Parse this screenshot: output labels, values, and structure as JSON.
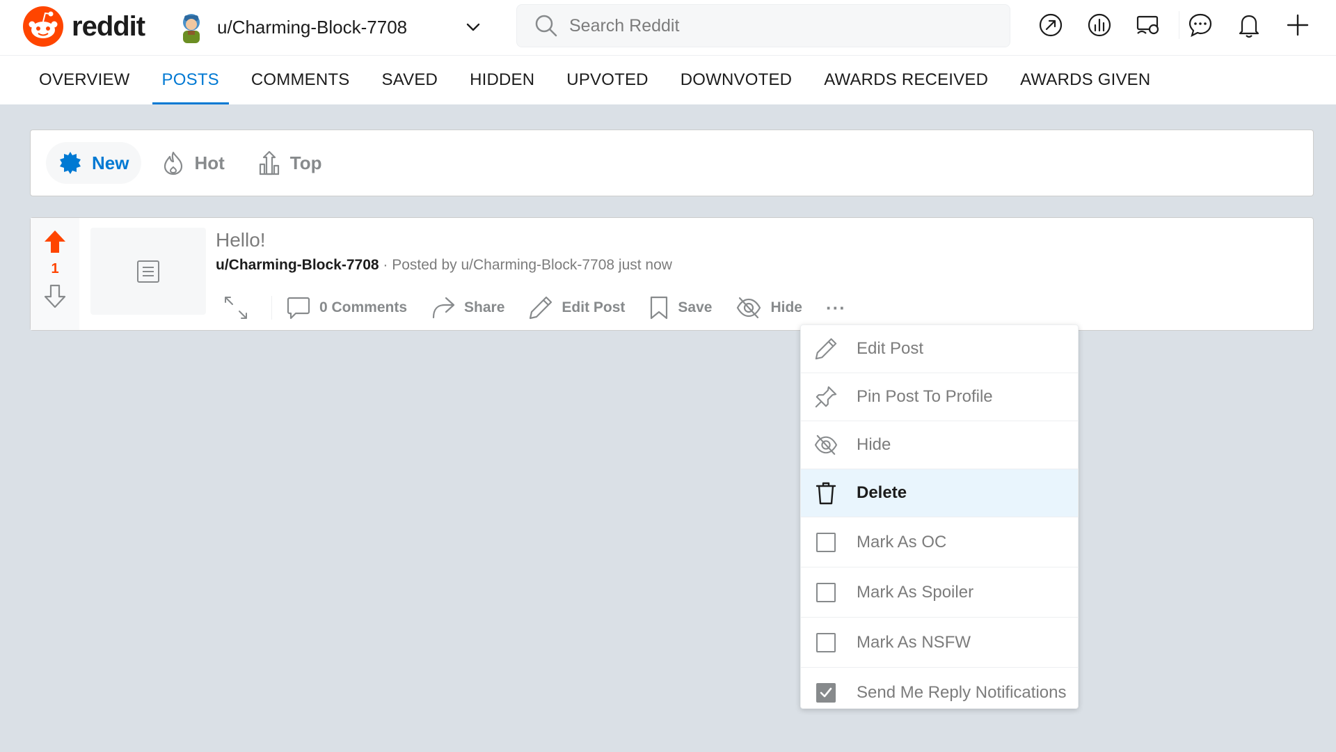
{
  "colors": {
    "brand": "#ff4500",
    "accent": "#0079d3",
    "muted": "#878a8c",
    "menu_highlight": "#e9f5fd"
  },
  "header": {
    "logo_text": "reddit",
    "username": "u/Charming-Block-7708",
    "search_placeholder": "Search Reddit",
    "icons": [
      "popular-icon",
      "stats-icon",
      "coins-icon",
      "chat-icon",
      "notification-icon",
      "create-post-icon"
    ]
  },
  "tabs": [
    {
      "label": "OVERVIEW"
    },
    {
      "label": "POSTS",
      "active": true
    },
    {
      "label": "COMMENTS"
    },
    {
      "label": "SAVED"
    },
    {
      "label": "HIDDEN"
    },
    {
      "label": "UPVOTED"
    },
    {
      "label": "DOWNVOTED"
    },
    {
      "label": "AWARDS RECEIVED"
    },
    {
      "label": "AWARDS GIVEN"
    }
  ],
  "sort": {
    "new": "New",
    "hot": "Hot",
    "top": "Top"
  },
  "post": {
    "score": "1",
    "title": "Hello!",
    "author": "u/Charming-Block-7708",
    "posted_by": "· Posted by u/Charming-Block-7708 just now",
    "actions": {
      "comments": "0 Comments",
      "share": "Share",
      "edit": "Edit Post",
      "save": "Save",
      "hide": "Hide",
      "more": "···"
    }
  },
  "menu": {
    "edit": "Edit Post",
    "pin": "Pin Post To Profile",
    "hide": "Hide",
    "delete": "Delete",
    "mark_oc": "Mark As OC",
    "mark_spoiler": "Mark As Spoiler",
    "mark_nsfw": "Mark As NSFW",
    "reply_notifications": "Send Me Reply Notifications"
  }
}
